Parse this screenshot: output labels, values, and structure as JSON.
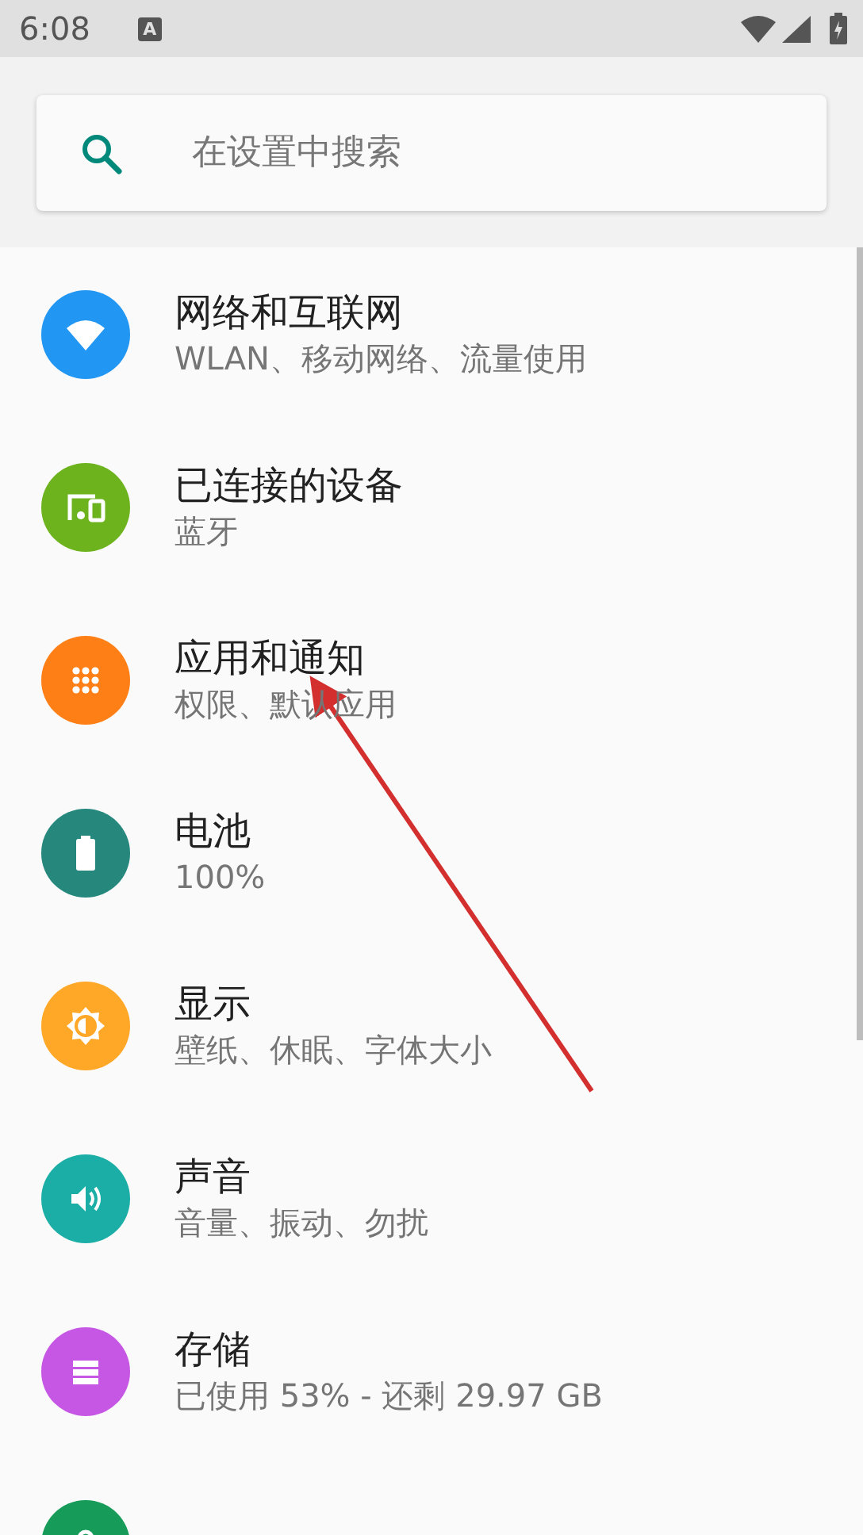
{
  "status_bar": {
    "time": "6:08",
    "notification": "A"
  },
  "search": {
    "placeholder": "在设置中搜索"
  },
  "items": [
    {
      "kind": "wifi",
      "color": "#2196f3",
      "title": "网络和互联网",
      "subtitle": "WLAN、移动网络、流量使用"
    },
    {
      "kind": "devices",
      "color": "#6db31e",
      "title": "已连接的设备",
      "subtitle": "蓝牙"
    },
    {
      "kind": "apps",
      "color": "#ff7f17",
      "title": "应用和通知",
      "subtitle": "权限、默认应用"
    },
    {
      "kind": "battery",
      "color": "#26877d",
      "title": "电池",
      "subtitle": "100%"
    },
    {
      "kind": "display",
      "color": "#ffa726",
      "title": "显示",
      "subtitle": "壁纸、休眠、字体大小"
    },
    {
      "kind": "sound",
      "color": "#1aaea6",
      "title": "声音",
      "subtitle": "音量、振动、勿扰"
    },
    {
      "kind": "storage",
      "color": "#c657e4",
      "title": "存储",
      "subtitle": "已使用 53% - 还剩 29.97 GB"
    },
    {
      "kind": "security",
      "color": "#179b59"
    }
  ]
}
